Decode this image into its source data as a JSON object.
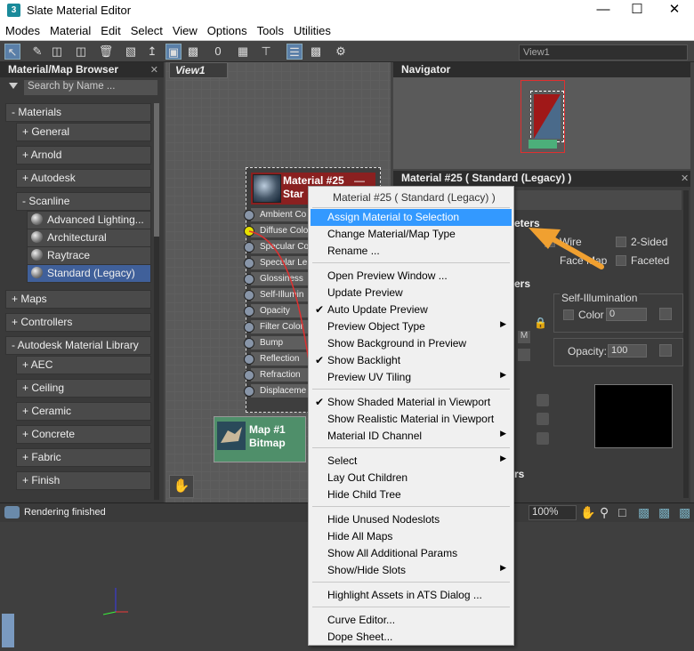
{
  "window": {
    "title": "Slate Material Editor",
    "app_icon": "3"
  },
  "menu": [
    "Modes",
    "Material",
    "Edit",
    "Select",
    "View",
    "Options",
    "Tools",
    "Utilities"
  ],
  "view_dropdown": "View1",
  "browser": {
    "title": "Material/Map Browser",
    "search_placeholder": "Search by Name ...",
    "items": [
      "- Materials",
      "+ General",
      "+ Arnold",
      "+ Autodesk",
      "- Scanline",
      "Advanced Lighting...",
      "Architectural",
      "Raytrace",
      "Standard (Legacy)",
      "+ Maps",
      "+ Controllers",
      "- Autodesk Material Library",
      "+ AEC",
      "+ Ceiling",
      "+ Ceramic",
      "+ Concrete",
      "+ Fabric",
      "+ Finish"
    ]
  },
  "view_tab": "View1",
  "material_node": {
    "title_line1": "Material #25",
    "title_line2": "Star",
    "slots": [
      "Ambient Co",
      "Diffuse Colo",
      "Specular Co",
      "Specular Le",
      "Glossiness",
      "Self-Illumin",
      "Opacity",
      "Filter Color",
      "Bump",
      "Reflection",
      "Refraction",
      "Displaceme"
    ]
  },
  "map_node": {
    "line1": "Map #1",
    "line2": "Bitmap"
  },
  "navigator": {
    "title": "Navigator"
  },
  "param_panel": {
    "title": "Material #25  ( Standard (Legacy) )",
    "section1": "eters",
    "wire": "Wire",
    "two_sided": "2-Sided",
    "face_map": "Face Map",
    "faceted": "Faceted",
    "section2": "ers",
    "m_label": "M",
    "self_illum": "Self-Illumination",
    "color_label": "Color",
    "color_value": "0",
    "opacity_label": "Opacity:",
    "opacity_value": "100",
    "section3": "rs"
  },
  "status": {
    "text": "Rendering finished",
    "zoom": "100%"
  },
  "context_menu": {
    "header": "Material #25  ( Standard (Legacy) )",
    "groups": [
      [
        {
          "label": "Assign Material to Selection",
          "hl": true
        },
        {
          "label": "Change Material/Map Type"
        },
        {
          "label": "Rename ..."
        }
      ],
      [
        {
          "label": "Open Preview Window ..."
        },
        {
          "label": "Update Preview"
        },
        {
          "label": "Auto Update Preview",
          "check": true
        },
        {
          "label": "Preview Object Type",
          "sub": true
        },
        {
          "label": "Show Background in Preview"
        },
        {
          "label": "Show Backlight",
          "check": true
        },
        {
          "label": "Preview UV Tiling",
          "sub": true
        }
      ],
      [
        {
          "label": "Show Shaded Material in Viewport",
          "check": true
        },
        {
          "label": "Show Realistic Material in Viewport"
        },
        {
          "label": "Material ID Channel",
          "sub": true
        }
      ],
      [
        {
          "label": "Select",
          "sub": true
        },
        {
          "label": "Lay Out Children"
        },
        {
          "label": "Hide Child Tree"
        }
      ],
      [
        {
          "label": "Hide Unused Nodeslots"
        },
        {
          "label": "Hide All Maps"
        },
        {
          "label": "Show All Additional Params"
        },
        {
          "label": "Show/Hide Slots",
          "sub": true
        }
      ],
      [
        {
          "label": "Highlight Assets in ATS Dialog ..."
        }
      ],
      [
        {
          "label": "Curve Editor..."
        },
        {
          "label": "Dope Sheet..."
        }
      ]
    ]
  },
  "colors": {
    "highlight": "#3399ff",
    "node_header": "#8a2020",
    "map_node": "#4f8f6a",
    "arrow": "#f0a030"
  }
}
